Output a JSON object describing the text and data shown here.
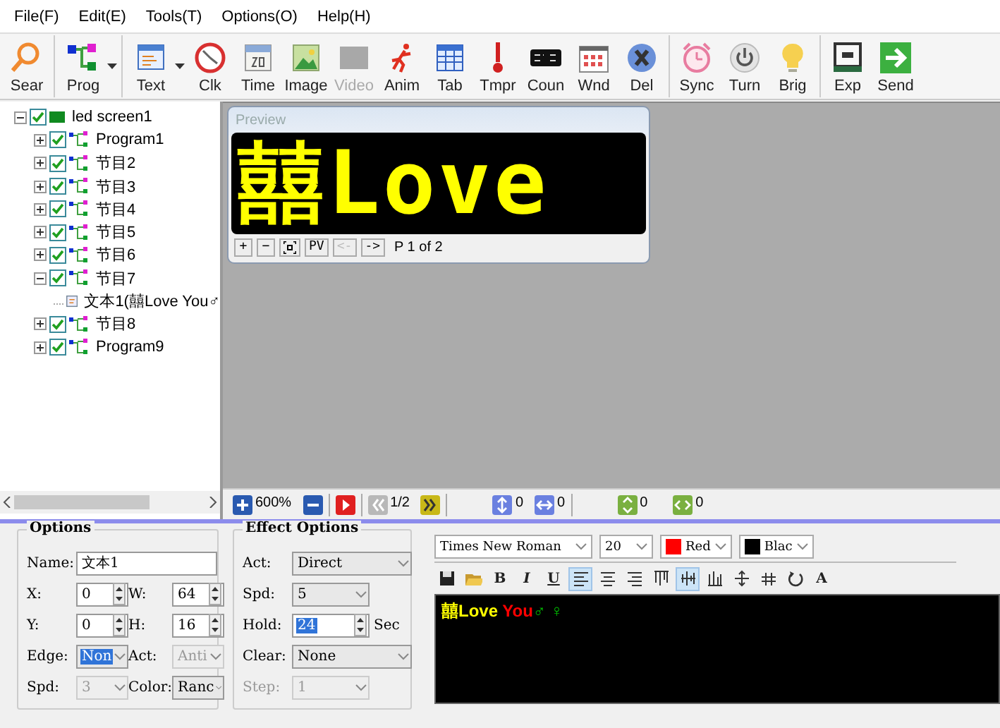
{
  "menu": [
    "File(F)",
    "Edit(E)",
    "Tools(T)",
    "Options(O)",
    "Help(H)"
  ],
  "toolbar_groups": [
    {
      "items": [
        {
          "label": "Sear",
          "disabled": false,
          "dropdown": false
        }
      ]
    },
    {
      "items": [
        {
          "label": "Prog",
          "disabled": false,
          "dropdown": true
        }
      ]
    },
    {
      "items": [
        {
          "label": "Text",
          "disabled": false,
          "dropdown": true
        },
        {
          "label": "Clk",
          "disabled": false,
          "dropdown": false
        },
        {
          "label": "Time",
          "disabled": false,
          "dropdown": false
        },
        {
          "label": "Image",
          "disabled": false,
          "dropdown": false
        },
        {
          "label": "Video",
          "disabled": true,
          "dropdown": false
        },
        {
          "label": "Anim",
          "disabled": false,
          "dropdown": false
        },
        {
          "label": "Tab",
          "disabled": false,
          "dropdown": false
        },
        {
          "label": "Tmpr",
          "disabled": false,
          "dropdown": false
        },
        {
          "label": "Coun",
          "disabled": false,
          "dropdown": false
        },
        {
          "label": "Wnd",
          "disabled": false,
          "dropdown": false
        },
        {
          "label": "Del",
          "disabled": false,
          "dropdown": false
        }
      ]
    },
    {
      "items": [
        {
          "label": "Sync",
          "disabled": false,
          "dropdown": false
        },
        {
          "label": "Turn",
          "disabled": false,
          "dropdown": false
        },
        {
          "label": "Brig",
          "disabled": false,
          "dropdown": false
        }
      ]
    },
    {
      "items": [
        {
          "label": "Exp",
          "disabled": false,
          "dropdown": false
        },
        {
          "label": "Send",
          "disabled": false,
          "dropdown": false
        }
      ]
    }
  ],
  "tree": {
    "label": "led screen1",
    "checked": true,
    "expanded": true,
    "children": [
      {
        "label": "Program1",
        "checked": true,
        "expanded": false
      },
      {
        "label": "节目2",
        "checked": true,
        "expanded": false
      },
      {
        "label": "节目3",
        "checked": true,
        "expanded": false
      },
      {
        "label": "节目4",
        "checked": true,
        "expanded": false
      },
      {
        "label": "节目5",
        "checked": true,
        "expanded": false
      },
      {
        "label": "节目6",
        "checked": true,
        "expanded": false
      },
      {
        "label": "节目7",
        "checked": true,
        "expanded": true,
        "children": [
          {
            "label": "文本1(囍Love You♂",
            "kind": "text"
          }
        ]
      },
      {
        "label": "节目8",
        "checked": true,
        "expanded": false
      },
      {
        "label": "Program9",
        "checked": true,
        "expanded": false
      }
    ]
  },
  "preview": {
    "title": "Preview",
    "display": "囍Love",
    "controls": [
      {
        "kind": "button",
        "label": "+",
        "disabled": false
      },
      {
        "kind": "button",
        "label": "−",
        "disabled": false
      },
      {
        "kind": "fit",
        "disabled": false
      },
      {
        "kind": "button",
        "label": "PV",
        "disabled": false
      },
      {
        "kind": "button",
        "label": "<-",
        "disabled": true
      },
      {
        "kind": "button",
        "label": "->",
        "disabled": false
      }
    ],
    "page": "P 1 of 2"
  },
  "status_bar": [
    {
      "kind": "zoom-in",
      "text": "600%"
    },
    {
      "kind": "zoom-out"
    },
    {
      "kind": "play"
    },
    {
      "kind": "previous",
      "text": "1/2"
    },
    {
      "kind": "next"
    },
    {
      "kind": "vertical",
      "text": "0"
    },
    {
      "kind": "horizontal",
      "text": "0"
    },
    {
      "kind": "expand",
      "text": "0"
    },
    {
      "kind": "shrink",
      "text": "0"
    }
  ],
  "options": {
    "title": "Options",
    "rows": [
      [
        {
          "label": "Name:",
          "kind": "text",
          "value": "文本1",
          "disabled": false,
          "selected": false
        }
      ],
      [
        {
          "label": "X:",
          "kind": "spin",
          "value": "0",
          "disabled": false,
          "selected": false
        },
        {
          "label": "W:",
          "kind": "spin",
          "value": "64",
          "disabled": false,
          "selected": false
        }
      ],
      [
        {
          "label": "Y:",
          "kind": "spin",
          "value": "0",
          "disabled": false,
          "selected": false
        },
        {
          "label": "H:",
          "kind": "spin",
          "value": "16",
          "disabled": false,
          "selected": false
        }
      ],
      [
        {
          "label": "Edge:",
          "kind": "dropdown",
          "value": "Non",
          "disabled": false,
          "selected": true
        },
        {
          "label": "Act:",
          "kind": "dropdown",
          "value": "Anti",
          "disabled": true,
          "selected": false
        }
      ],
      [
        {
          "label": "Spd:",
          "kind": "dropdown",
          "value": "3",
          "disabled": true,
          "selected": false
        },
        {
          "label": "Color:",
          "kind": "dropdown",
          "value": "Ranc",
          "disabled": false,
          "selected": false
        }
      ]
    ]
  },
  "effect_options": {
    "title": "Effect Options",
    "rows": [
      [
        {
          "label": "Act:",
          "kind": "dropdown",
          "value": "Direct",
          "disabled": false,
          "selected": false
        }
      ],
      [
        {
          "label": "Spd:",
          "kind": "dropdown",
          "value": "5",
          "disabled": false,
          "selected": false
        }
      ],
      [
        {
          "label": "Hold:",
          "kind": "spin",
          "value": "24",
          "disabled": false,
          "selected": true,
          "unit": "Sec"
        }
      ],
      [
        {
          "label": "Clear:",
          "kind": "dropdown",
          "value": "None",
          "disabled": false,
          "selected": false
        }
      ],
      [
        {
          "label": "Step:",
          "kind": "dropdown",
          "value": "1",
          "disabled": true,
          "selected": false
        }
      ]
    ]
  },
  "editor": {
    "font": "Times New Roman",
    "size": "20",
    "text_color": {
      "label": "Red",
      "color": "#ff0000"
    },
    "background_color": {
      "label": "Blac",
      "color": "#000000"
    },
    "format_buttons": [
      {
        "kind": "save",
        "selected": false
      },
      {
        "kind": "open",
        "selected": false
      },
      {
        "kind": "bold",
        "label": "B",
        "selected": false
      },
      {
        "kind": "italic",
        "label": "I",
        "selected": false
      },
      {
        "kind": "underline",
        "label": "U",
        "selected": false
      },
      {
        "kind": "align-left",
        "selected": true
      },
      {
        "kind": "align-center",
        "selected": false
      },
      {
        "kind": "align-right",
        "selected": false
      },
      {
        "kind": "align-top",
        "selected": false
      },
      {
        "kind": "align-middle",
        "selected": true
      },
      {
        "kind": "align-bottom",
        "selected": false
      },
      {
        "kind": "line-spacing",
        "selected": false
      },
      {
        "kind": "char-spacing",
        "selected": false
      },
      {
        "kind": "rotate",
        "selected": false
      },
      {
        "kind": "text-effect",
        "label": "A",
        "selected": false
      }
    ],
    "content": [
      {
        "text": "囍Love",
        "color": "#ffff00"
      },
      {
        "text": " You",
        "color": "#ff0000"
      },
      {
        "text": "♂ ♀",
        "color": "#00c000"
      }
    ]
  }
}
